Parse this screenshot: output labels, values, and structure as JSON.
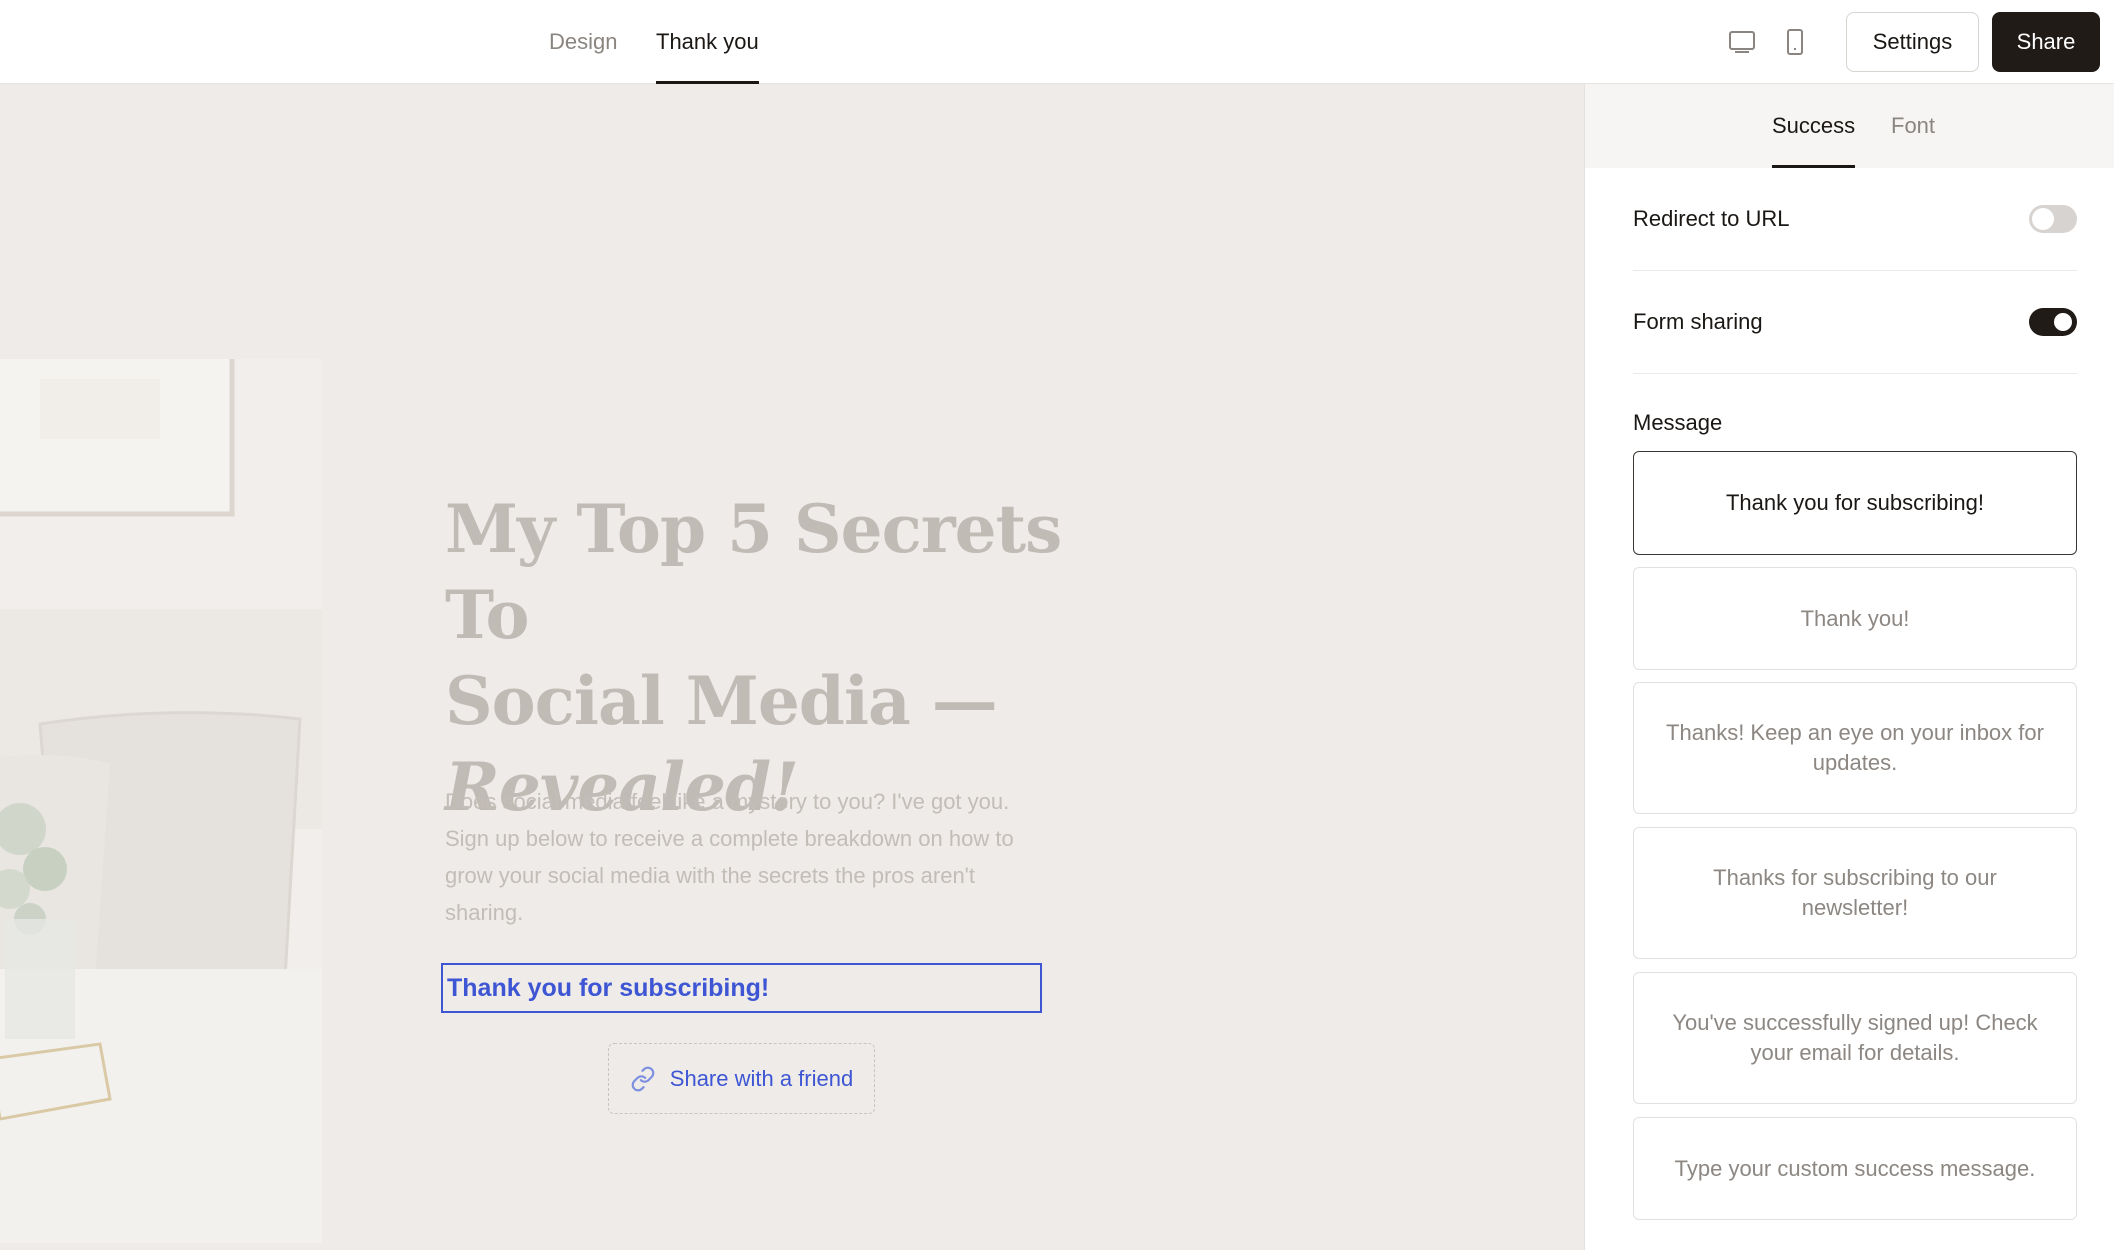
{
  "topbar": {
    "tabs": [
      {
        "label": "Design",
        "active": false
      },
      {
        "label": "Thank you",
        "active": true
      }
    ],
    "device_icons": [
      "desktop-icon",
      "mobile-icon"
    ],
    "settings_label": "Settings",
    "share_label": "Share"
  },
  "canvas": {
    "title_line1": "My Top 5 Secrets To",
    "title_line2": "Social Media —",
    "title_line3": "Revealed!",
    "description": "Does social media feel like a mystery to you? I've got you. Sign up below to receive a complete breakdown on how to grow your social media with the secrets the pros aren't sharing.",
    "success_message": "Thank you for subscribing!",
    "share_button_label": "Share with a friend",
    "share_icon": "link-icon",
    "accent_color": "#3e56d4"
  },
  "panel": {
    "tabs": [
      {
        "label": "Success",
        "active": true
      },
      {
        "label": "Font",
        "active": false
      }
    ],
    "redirect": {
      "label": "Redirect to URL",
      "enabled": false
    },
    "sharing": {
      "label": "Form sharing",
      "enabled": true
    },
    "message_label": "Message",
    "options": [
      {
        "text": "Thank you for subscribing!",
        "selected": true
      },
      {
        "text": "Thank you!",
        "selected": false
      },
      {
        "text": "Thanks! Keep an eye on your inbox for updates.",
        "selected": false
      },
      {
        "text": "Thanks for subscribing to our newsletter!",
        "selected": false
      },
      {
        "text": "You've successfully signed up! Check your email for details.",
        "selected": false
      },
      {
        "text": "Type your custom success message.",
        "selected": false
      }
    ]
  }
}
